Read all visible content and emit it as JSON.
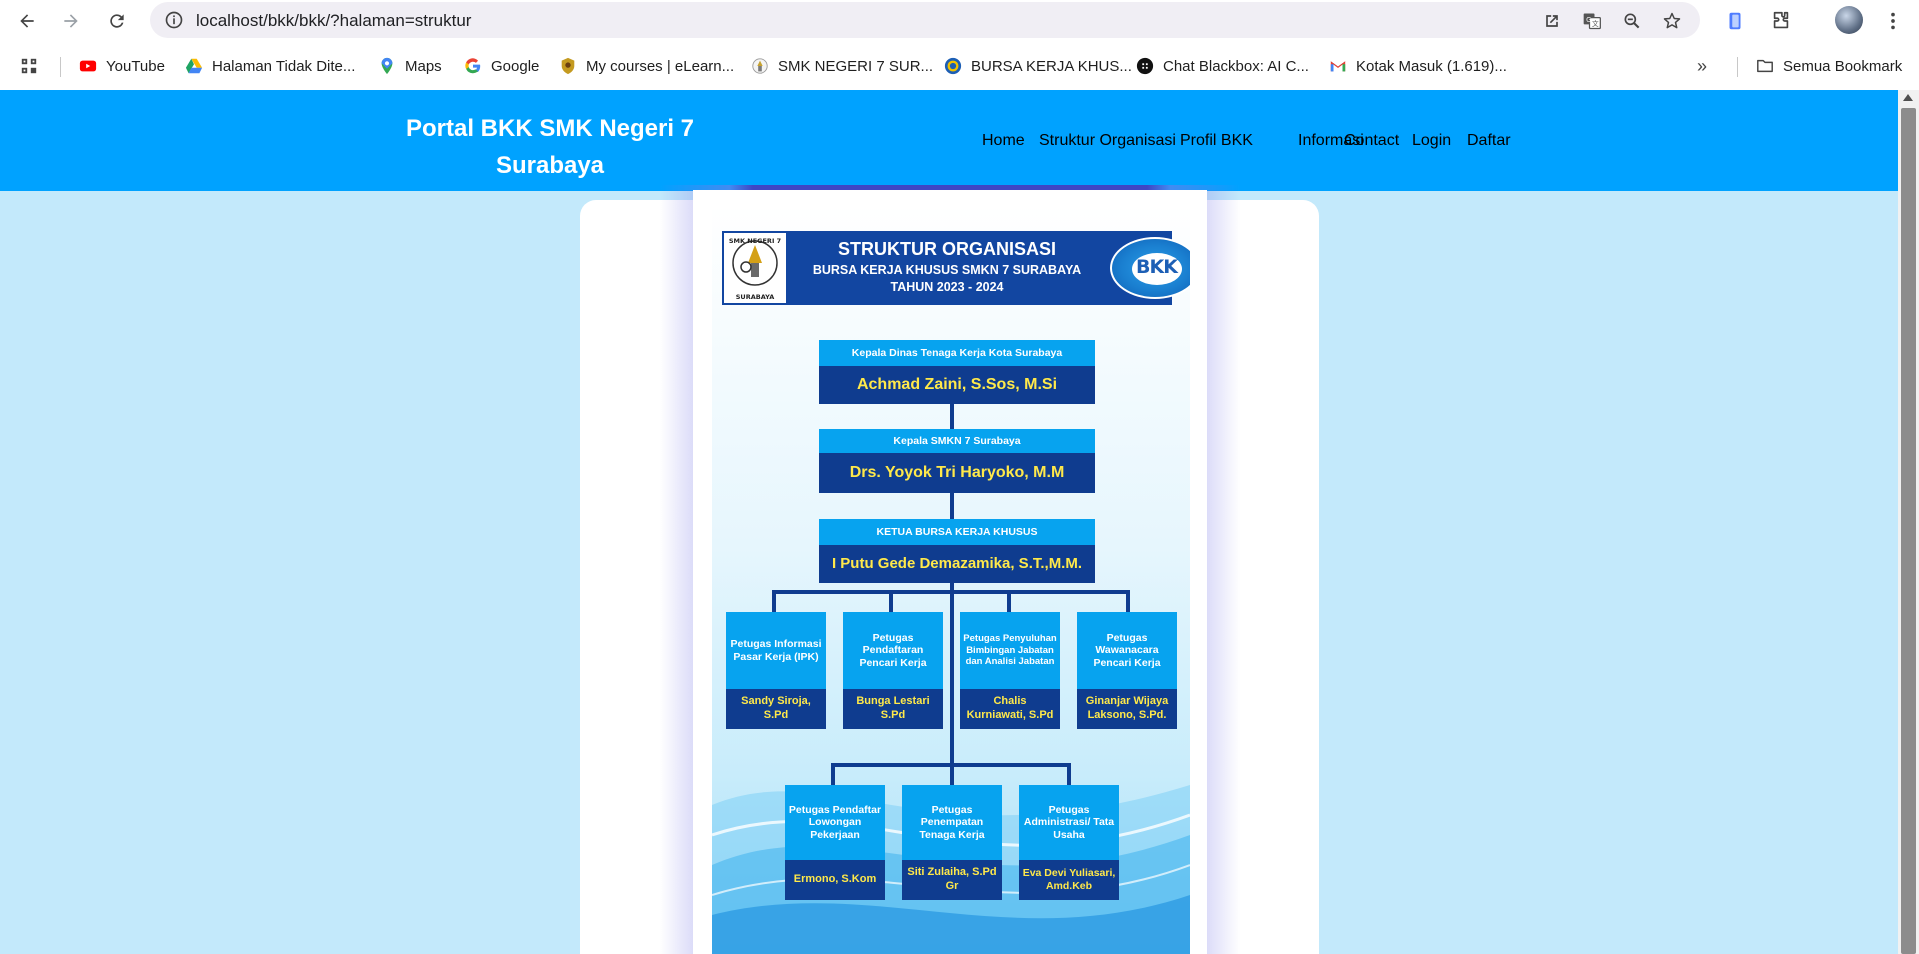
{
  "browser": {
    "url": "localhost/bkk/bkk/?halaman=struktur",
    "bookmarks": [
      {
        "label": "YouTube",
        "icon": "youtube-icon"
      },
      {
        "label": "Halaman Tidak Dite...",
        "icon": "drive-icon"
      },
      {
        "label": "Maps",
        "icon": "maps-icon"
      },
      {
        "label": "Google",
        "icon": "google-icon"
      },
      {
        "label": "My courses | eLearn...",
        "icon": "elearning-icon"
      },
      {
        "label": "SMK NEGERI 7 SUR...",
        "icon": "school-icon"
      },
      {
        "label": "BURSA KERJA KHUS...",
        "icon": "bkk-icon"
      },
      {
        "label": "Chat Blackbox: AI C...",
        "icon": "blackbox-icon"
      },
      {
        "label": "Kotak Masuk (1.619)...",
        "icon": "gmail-icon"
      }
    ],
    "all_bookmarks": "Semua Bookmark"
  },
  "site": {
    "brand": "Portal BKK SMK Negeri 7 Surabaya",
    "menu": [
      "Home",
      "Struktur Organisasi",
      "Profil BKK",
      "Informasi",
      "Contact",
      "Login",
      "Daftar"
    ]
  },
  "poster": {
    "title": "STRUKTUR ORGANISASI",
    "subtitle": "BURSA KERJA KHUSUS SMKN 7 SURABAYA",
    "year": "TAHUN 2023 - 2024",
    "logo_left_top": "SMK NEGERI 7",
    "logo_left_bottom": "SURABAYA",
    "logo_right": "BKK",
    "boxes": {
      "dinas": {
        "role": "Kepala Dinas Tenaga Kerja Kota Surabaya",
        "name": "Achmad Zaini, S.Sos, M.Si"
      },
      "kepsek": {
        "role": "Kepala SMKN 7 Surabaya",
        "name": "Drs. Yoyok Tri Haryoko, M.M"
      },
      "ketua": {
        "role": "KETUA BURSA KERJA KHUSUS",
        "name": "I Putu Gede Demazamika, S.T.,M.M."
      },
      "ipk": {
        "role": "Petugas Informasi Pasar Kerja (IPK)",
        "name": "Sandy Siroja, S.Pd"
      },
      "pendaftaran": {
        "role": "Petugas Pendaftaran Pencari Kerja",
        "name": "Bunga Lestari S.Pd"
      },
      "penyuluhan": {
        "role": "Petugas Penyuluhan Bimbingan Jabatan dan Analisi Jabatan",
        "name": "Chalis Kurniawati, S.Pd"
      },
      "wawancara": {
        "role": "Petugas Wawanacara Pencari Kerja",
        "name": "Ginanjar Wijaya Laksono, S.Pd."
      },
      "lowongan": {
        "role": "Petugas Pendaftar Lowongan Pekerjaan",
        "name": "Ermono, S.Kom"
      },
      "penempatan": {
        "role": "Petugas Penempatan Tenaga Kerja",
        "name": "Siti Zulaiha, S.Pd Gr"
      },
      "administrasi": {
        "role": "Petugas Administrasi/ Tata Usaha",
        "name": "Eva Devi Yuliasari, Amd.Keb"
      }
    }
  }
}
